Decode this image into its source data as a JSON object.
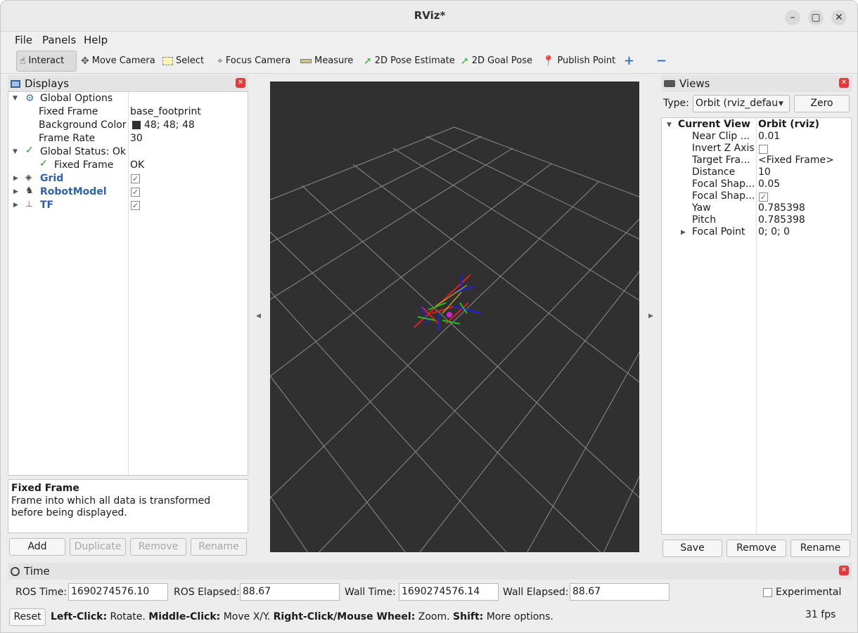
{
  "window": {
    "title": "RViz*"
  },
  "menu": [
    "File",
    "Panels",
    "Help"
  ],
  "toolbar": {
    "interact": "Interact",
    "move_camera": "Move Camera",
    "select": "Select",
    "focus_camera": "Focus Camera",
    "measure": "Measure",
    "pose_estimate": "2D Pose Estimate",
    "goal_pose": "2D Goal Pose",
    "publish_point": "Publish Point"
  },
  "displays": {
    "title": "Displays",
    "global_options": "Global Options",
    "fixed_frame_label": "Fixed Frame",
    "fixed_frame_value": "base_footprint",
    "bg_color_label": "Background Color",
    "bg_color_value": "48; 48; 48",
    "bg_color_swatch": "#303030",
    "frame_rate_label": "Frame Rate",
    "frame_rate_value": "30",
    "global_status": "Global Status: Ok",
    "status_fixed_frame": "Fixed Frame",
    "status_fixed_frame_value": "OK",
    "items": [
      "Grid",
      "RobotModel",
      "TF"
    ],
    "desc_title": "Fixed Frame",
    "desc_text": "Frame into which all data is transformed before being displayed.",
    "buttons": {
      "add": "Add",
      "duplicate": "Duplicate",
      "remove": "Remove",
      "rename": "Rename"
    }
  },
  "views": {
    "title": "Views",
    "type_label": "Type:",
    "type_value": "Orbit (rviz_defau",
    "zero": "Zero",
    "current_view": "Current View",
    "current_view_value": "Orbit (rviz)",
    "props": [
      {
        "label": "Near Clip ...",
        "value": "0.01"
      },
      {
        "label": "Invert Z Axis",
        "value": ""
      },
      {
        "label": "Target Fra...",
        "value": "<Fixed Frame>"
      },
      {
        "label": "Distance",
        "value": "10"
      },
      {
        "label": "Focal Shap...",
        "value": "0.05"
      },
      {
        "label": "Focal Shap...",
        "value": ""
      },
      {
        "label": "Yaw",
        "value": "0.785398"
      },
      {
        "label": "Pitch",
        "value": "0.785398"
      },
      {
        "label": "Focal Point",
        "value": "0; 0; 0"
      }
    ],
    "buttons": {
      "save": "Save",
      "remove": "Remove",
      "rename": "Rename"
    }
  },
  "time": {
    "title": "Time",
    "ros_time_label": "ROS Time:",
    "ros_time": "1690274576.10",
    "ros_elapsed_label": "ROS Elapsed:",
    "ros_elapsed": "88.67",
    "wall_time_label": "Wall Time:",
    "wall_time": "1690274576.14",
    "wall_elapsed_label": "Wall Elapsed:",
    "wall_elapsed": "88.67",
    "experimental": "Experimental"
  },
  "status": {
    "reset": "Reset",
    "hint_1_bold": "Left-Click:",
    "hint_1": " Rotate. ",
    "hint_2_bold": "Middle-Click:",
    "hint_2": " Move X/Y. ",
    "hint_3_bold": "Right-Click/Mouse Wheel:",
    "hint_3": " Zoom. ",
    "hint_4_bold": "Shift:",
    "hint_4": " More options.",
    "fps": "31 fps"
  }
}
